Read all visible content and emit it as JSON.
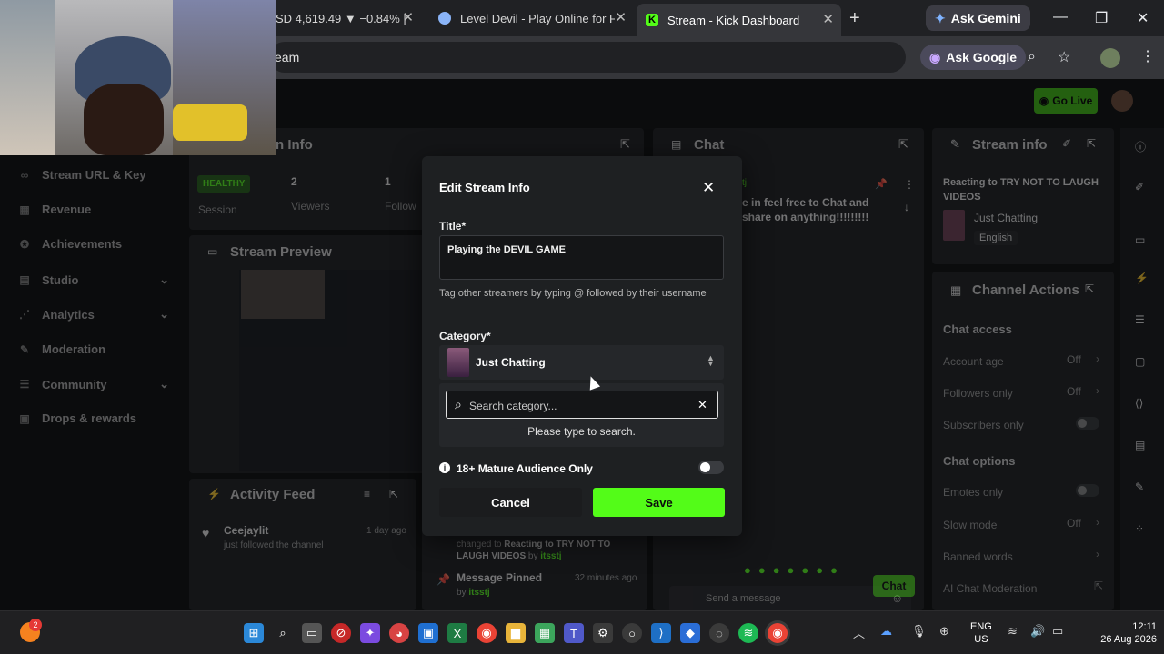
{
  "browser": {
    "tabs": [
      {
        "label": "SD 4,619.49 ▼ −0.84% |",
        "active": false
      },
      {
        "label": "Level Devil - Play Online for Fr",
        "active": false
      },
      {
        "label": "Stream - Kick Dashboard",
        "active": true
      }
    ],
    "new_tab": "+",
    "ask_gemini": "Ask Gemini",
    "address_fragment": "eam",
    "ask_google": "Ask Google"
  },
  "dashboard": {
    "go_live": "Go Live",
    "stream_info_left_header": "n Info",
    "chat_header": "Chat",
    "stream_info_right_header": "Stream info",
    "sidebar": [
      {
        "label": "Stream URL & Key",
        "icon": "link-icon"
      },
      {
        "label": "Revenue",
        "icon": "revenue-icon"
      },
      {
        "label": "Achievements",
        "icon": "trophy-icon"
      },
      {
        "label": "Studio",
        "icon": "studio-icon",
        "chevron": true
      },
      {
        "label": "Analytics",
        "icon": "analytics-icon",
        "chevron": true
      },
      {
        "label": "Moderation",
        "icon": "wrench-icon"
      },
      {
        "label": "Community",
        "icon": "community-icon",
        "chevron": true
      },
      {
        "label": "Drops & rewards",
        "icon": "gift-icon"
      }
    ],
    "stats": {
      "healthy": "HEALTHY",
      "session": "Session",
      "viewers_value": "2",
      "viewers_label": "Viewers",
      "followers_value": "1",
      "followers_label": "Follow"
    },
    "stream_preview": "Stream Preview",
    "activity_feed": {
      "title": "Activity Feed",
      "items": [
        {
          "user": "Ceejaylit",
          "time": "1 day ago",
          "text": "just followed the channel"
        }
      ]
    },
    "chat_pinned": {
      "user": "tj",
      "text": "e in feel free to Chat and share on anything!!!!!!!!!"
    },
    "feed_mid": {
      "change_prefix": "changed to ",
      "change_title": "Reacting to TRY NOT TO LAUGH VIDEOS",
      "by": " by ",
      "change_user": "itsstj",
      "pinned_title": "Message Pinned",
      "pinned_time": "32 minutes ago",
      "pinned_by": "by ",
      "pinned_user": "itsstj"
    },
    "chat_input_placeholder": "Send a message",
    "chat_button": "Chat",
    "info_right": {
      "title": "Reacting to TRY NOT TO LAUGH VIDEOS",
      "category": "Just Chatting",
      "language": "English"
    },
    "channel_actions": {
      "title": "Channel Actions",
      "chat_access": "Chat access",
      "rows_access": [
        {
          "label": "Account age",
          "value": "Off",
          "type": "value"
        },
        {
          "label": "Followers only",
          "value": "Off",
          "type": "value"
        },
        {
          "label": "Subscribers only",
          "value": "",
          "type": "toggle"
        }
      ],
      "chat_options": "Chat options",
      "rows_options": [
        {
          "label": "Emotes only",
          "value": "",
          "type": "toggle"
        },
        {
          "label": "Slow mode",
          "value": "Off",
          "type": "value"
        },
        {
          "label": "Banned words",
          "value": "",
          "type": "arrow"
        },
        {
          "label": "AI Chat Moderation",
          "value": "",
          "type": "external"
        }
      ]
    }
  },
  "modal": {
    "title": "Edit Stream Info",
    "title_label": "Title*",
    "title_value": "Playing the DEVIL GAME",
    "tag_hint": "Tag other streamers by typing @ followed by their username",
    "category_label": "Category*",
    "category_value": "Just Chatting",
    "search_placeholder": "Search category...",
    "search_hint": "Please type to search.",
    "mature_label": "18+ Mature Audience Only",
    "mature_on": false,
    "cancel": "Cancel",
    "save": "Save"
  },
  "taskbar": {
    "notification_count": "2",
    "lang_top": "ENG",
    "lang_bottom": "US",
    "time": "12:11",
    "date": "26 Aug 2026"
  },
  "colors": {
    "kick_green": "#53fc18",
    "chrome_dark": "#202124",
    "panel": "#141517",
    "modal": "#1e2022"
  }
}
